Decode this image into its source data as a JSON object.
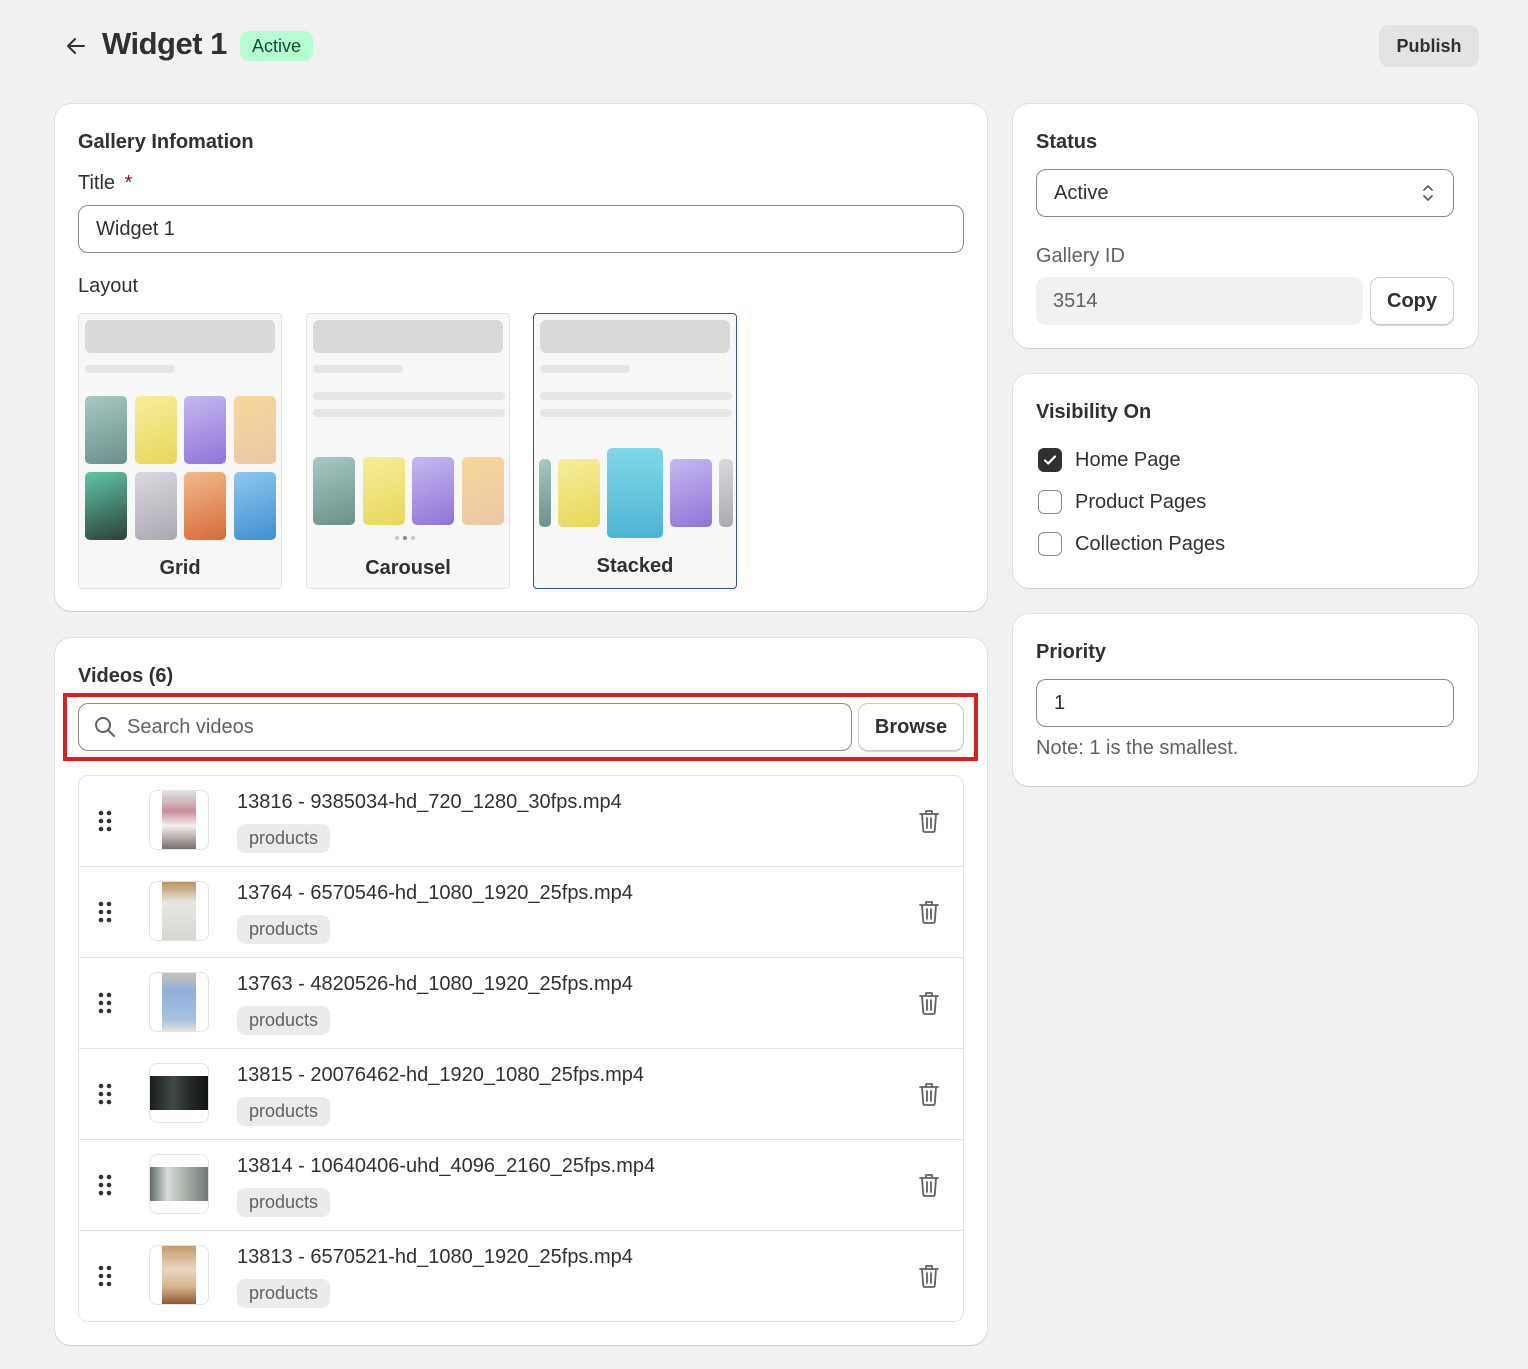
{
  "header": {
    "title": "Widget 1",
    "status_badge": "Active",
    "publish_label": "Publish"
  },
  "gallery_info": {
    "heading": "Gallery Infomation",
    "title_label": "Title",
    "required_marker": "*",
    "title_value": "Widget 1",
    "layout_label": "Layout",
    "layouts": [
      {
        "label": "Grid",
        "selected": false
      },
      {
        "label": "Carousel",
        "selected": false
      },
      {
        "label": "Stacked",
        "selected": true
      }
    ]
  },
  "videos": {
    "heading": "Videos (6)",
    "search_placeholder": "Search videos",
    "browse_label": "Browse",
    "items": [
      {
        "name": "13816 - 9385034-hd_720_1280_30fps.mp4",
        "tag": "products"
      },
      {
        "name": "13764 - 6570546-hd_1080_1920_25fps.mp4",
        "tag": "products"
      },
      {
        "name": "13763 - 4820526-hd_1080_1920_25fps.mp4",
        "tag": "products"
      },
      {
        "name": "13815 - 20076462-hd_1920_1080_25fps.mp4",
        "tag": "products"
      },
      {
        "name": "13814 - 10640406-uhd_4096_2160_25fps.mp4",
        "tag": "products"
      },
      {
        "name": "13813 - 6570521-hd_1080_1920_25fps.mp4",
        "tag": "products"
      }
    ]
  },
  "status_card": {
    "heading": "Status",
    "selected": "Active",
    "gallery_id_label": "Gallery ID",
    "gallery_id": "3514",
    "copy_label": "Copy"
  },
  "visibility": {
    "heading": "Visibility On",
    "options": [
      {
        "label": "Home Page",
        "checked": true
      },
      {
        "label": "Product Pages",
        "checked": false
      },
      {
        "label": "Collection Pages",
        "checked": false
      }
    ]
  },
  "priority": {
    "heading": "Priority",
    "value": "1",
    "note": "Note: 1 is the smallest."
  },
  "colors": {
    "badge_bg": "#b4fed2",
    "badge_text": "#0c5132",
    "selected_border": "#2c4fc0",
    "highlight": "#e01e1e"
  }
}
